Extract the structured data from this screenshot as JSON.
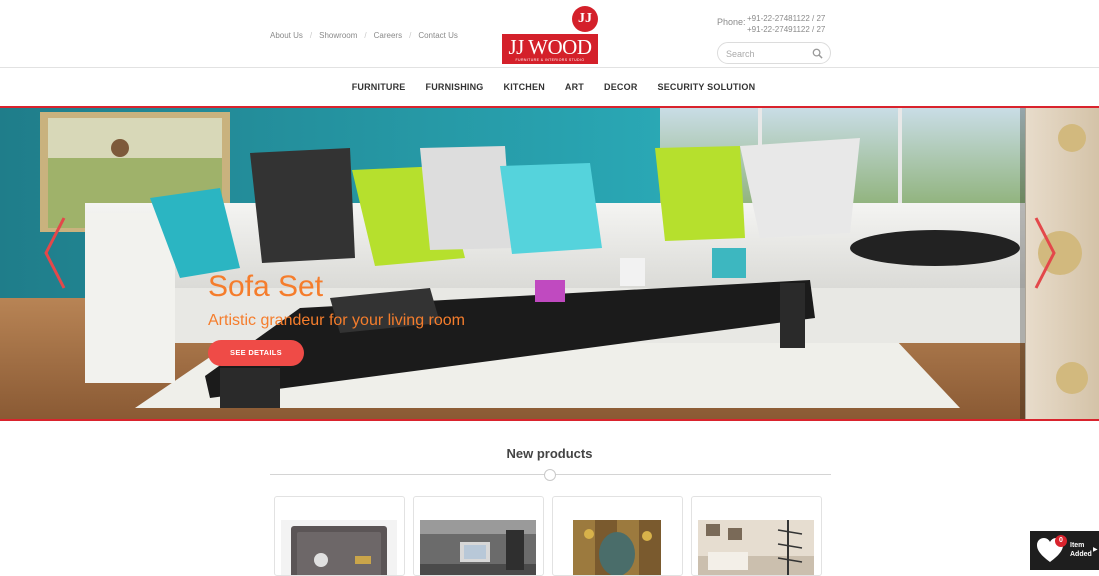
{
  "header": {
    "top_links": [
      "About Us",
      "Showroom",
      "Careers",
      "Contact Us"
    ],
    "logo": {
      "badge": "JJ",
      "word": "JJ WOOD",
      "tagline": "FURNITURE & INTERIORS STUDIO"
    },
    "phone_label": "Phone:",
    "phone_numbers": [
      "+91-22-27481122 / 27",
      "+91-22-27491122 / 27"
    ],
    "search_placeholder": "Search"
  },
  "nav": [
    "FURNITURE",
    "FURNISHING",
    "KITCHEN",
    "ART",
    "DECOR",
    "SECURITY SOLUTION"
  ],
  "hero": {
    "title": "Sofa Set",
    "subtitle": "Artistic grandeur for your living room",
    "cta_label": "SEE DETAILS"
  },
  "new_products": {
    "title": "New products",
    "items": [
      {
        "icon": "safe-image"
      },
      {
        "icon": "tv-unit-image"
      },
      {
        "icon": "buddha-panel-image"
      },
      {
        "icon": "living-room-image"
      }
    ]
  },
  "cart": {
    "count": "0",
    "line1": "Item",
    "line2": "Added",
    "caret": "▶"
  },
  "colors": {
    "accent": "#d9232d",
    "hero_text": "#f57d2c",
    "cta": "#ef4b47"
  }
}
